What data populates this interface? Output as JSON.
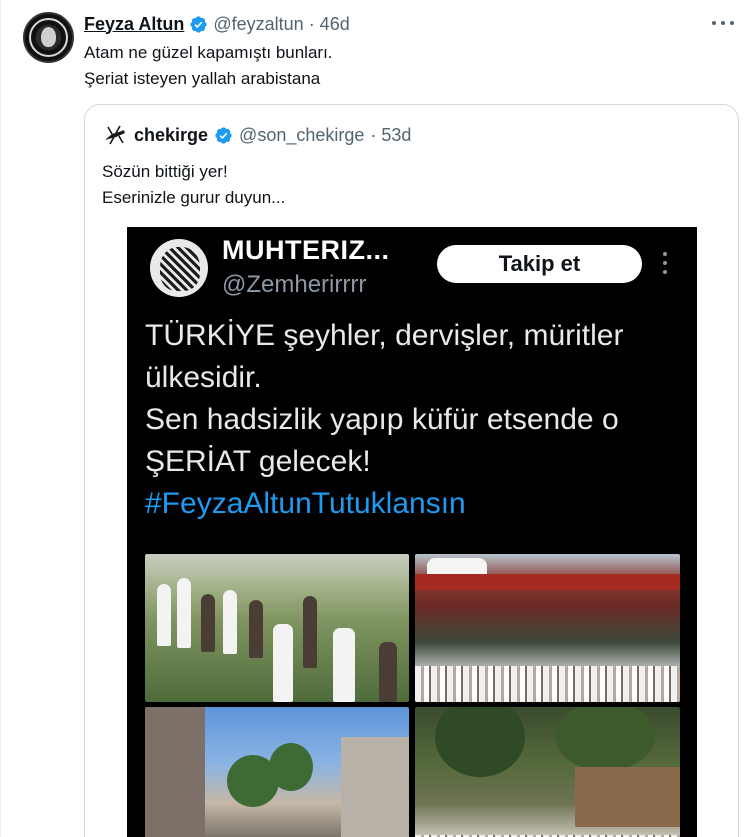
{
  "tweet": {
    "display_name": "Feyza Altun",
    "handle": "@feyzaltun",
    "time": "· 46d",
    "text_line1": "Atam ne güzel kapamıştı bunları.",
    "text_line2": "Şeriat isteyen yallah arabistana"
  },
  "quote": {
    "display_name": "chekirge",
    "handle": "@son_chekirge",
    "time": "· 53d",
    "text_line1": "Sözün bittiği yer!",
    "text_line2": "Eserinizle gurur duyun..."
  },
  "embedded": {
    "display_name": "MUHTERIZ...",
    "handle": "@Zemherirrrr",
    "follow_label": "Takip et",
    "text_lines": [
      "TÜRKİYE şeyhler, dervişler, müritler",
      "ülkesidir.",
      "Sen hadsizlik yapıp küfür etsende o",
      "ŞERİAT gelecek!"
    ],
    "hashtag": "#FeyzaAltunTutuklansın"
  },
  "colors": {
    "accent": "#1d9bf0",
    "text_primary": "#0f1419",
    "text_secondary": "#536471",
    "border": "#cfd9de"
  },
  "icons": [
    "verified-badge-icon",
    "more-options-icon"
  ]
}
